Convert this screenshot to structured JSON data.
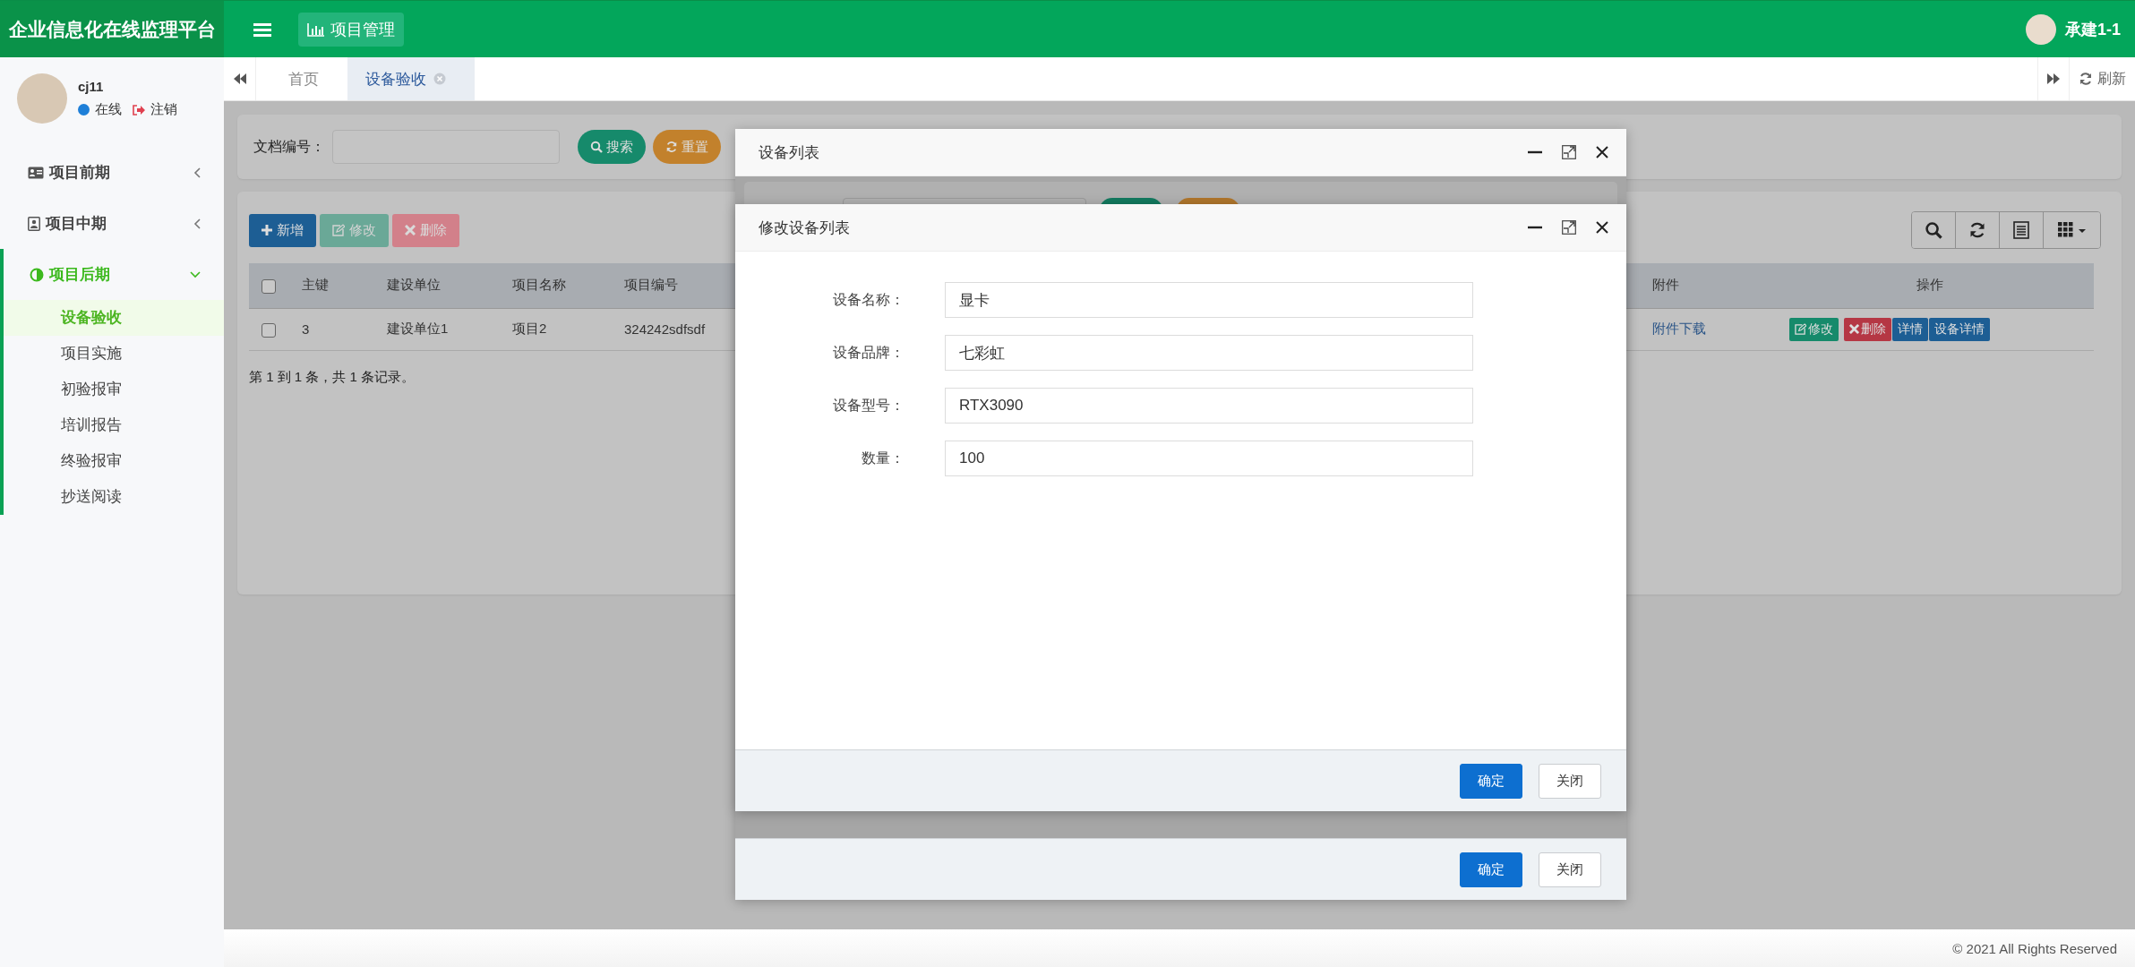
{
  "header": {
    "title": "企业信息化在线监理平台",
    "nav_button": "项目管理",
    "user": "承建1-1"
  },
  "sidebar": {
    "user": {
      "name": "cj11",
      "status": "在线",
      "logout": "注销"
    },
    "menu": [
      {
        "label": "项目前期",
        "kind": "card",
        "expanded": false
      },
      {
        "label": "项目中期",
        "kind": "portrait",
        "expanded": false
      },
      {
        "label": "项目后期",
        "kind": "half",
        "expanded": true,
        "children": [
          {
            "label": "设备验收",
            "selected": true
          },
          {
            "label": "项目实施",
            "selected": false
          },
          {
            "label": "初验报审",
            "selected": false
          },
          {
            "label": "培训报告",
            "selected": false
          },
          {
            "label": "终验报审",
            "selected": false
          },
          {
            "label": "抄送阅读",
            "selected": false
          }
        ]
      }
    ]
  },
  "tabs": [
    {
      "label": "首页",
      "selected": false,
      "closable": false
    },
    {
      "label": "设备验收",
      "selected": true,
      "closable": true
    }
  ],
  "tabs_refresh": "刷新",
  "search_form": {
    "label": "文档编号：",
    "buttons": [
      {
        "label": "搜索",
        "kind": "search"
      },
      {
        "label": "重置",
        "kind": "reset"
      }
    ]
  },
  "toolbar": [
    {
      "label": "新增",
      "kind": "add",
      "disabled": false
    },
    {
      "label": "修改",
      "kind": "edit",
      "disabled": true
    },
    {
      "label": "删除",
      "kind": "delete",
      "disabled": true
    }
  ],
  "table": {
    "header_checked": false,
    "columns": [
      "主键",
      "建设单位",
      "项目名称",
      "项目编号",
      "附件",
      "操作"
    ],
    "rows": [
      {
        "checked": false,
        "cells": [
          "3",
          "建设单位1",
          "项目2",
          "324242sdfsdf"
        ],
        "attachment": "附件下载",
        "actions": [
          {
            "label": "修改",
            "kind": "edit"
          },
          {
            "label": "删除",
            "kind": "delete"
          },
          {
            "label": "详情",
            "kind": "detail"
          },
          {
            "label": "设备详情",
            "kind": "detail"
          }
        ]
      }
    ]
  },
  "pagination": "第 1 到 1 条，共 1 条记录。",
  "dialogs": [
    {
      "title": "设备列表",
      "buttons": [
        {
          "label": "确定",
          "kind": "primary"
        },
        {
          "label": "关闭",
          "kind": "default"
        }
      ]
    },
    {
      "title": "修改设备列表",
      "fields": [
        {
          "label": "设备名称：",
          "value": "显卡"
        },
        {
          "label": "设备品牌：",
          "value": "七彩虹"
        },
        {
          "label": "设备型号：",
          "value": "RTX3090"
        },
        {
          "label": "数量：",
          "value": "100"
        }
      ],
      "buttons": [
        {
          "label": "确定",
          "kind": "primary"
        },
        {
          "label": "关闭",
          "kind": "default"
        }
      ]
    }
  ],
  "footer": "© 2021 All Rights Reserved"
}
